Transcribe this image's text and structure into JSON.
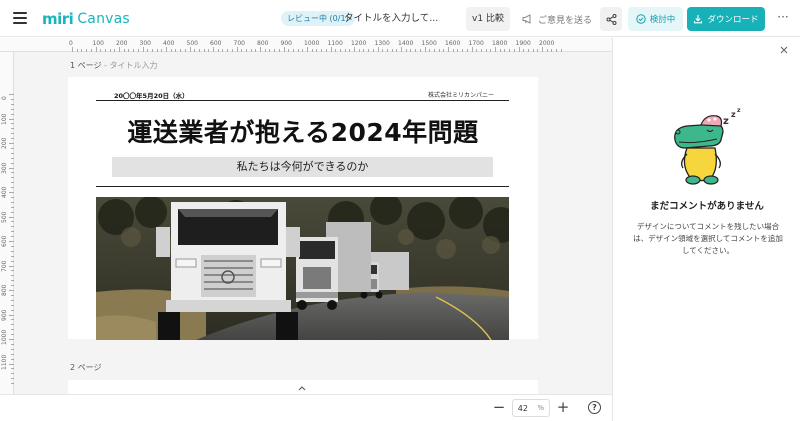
{
  "app": {
    "logo_mark": "miri",
    "logo_text": "Canvas"
  },
  "header": {
    "review_badge": "レビュー中 (0/1)",
    "doc_title": "タイトルを入力して...",
    "version_label": "v1 比較",
    "feedback_label": "ご意見を送る",
    "review_status_label": "検討中",
    "download_label": "ダウンロード",
    "more_label": "···"
  },
  "rulers": {
    "horizontal": [
      "0",
      "100",
      "200",
      "300",
      "400",
      "500",
      "600",
      "700",
      "800",
      "900",
      "1000",
      "1100",
      "1200",
      "1300",
      "1400",
      "1500",
      "1600",
      "1700",
      "1800",
      "1900",
      "2000"
    ],
    "vertical": [
      "0",
      "100",
      "200",
      "300",
      "400",
      "500",
      "600",
      "700",
      "800",
      "900",
      "1000",
      "1100"
    ]
  },
  "pages": [
    {
      "label": "1 ページ",
      "sub_label": "- タイトル入力",
      "date": "20〇〇年5月20日（水）",
      "company": "株式会社ミリカンパニー",
      "headline": "運送業者が抱える2024年問題",
      "subtitle": "私たちは今何ができるのか"
    },
    {
      "label": "2 ページ"
    }
  ],
  "zoom": {
    "value": "42",
    "unit": "%",
    "minus": "−",
    "plus": "+"
  },
  "help_label": "?",
  "comments_panel": {
    "empty_title": "まだコメントがありません",
    "empty_description": "デザインについてコメントを残したい場合は、デザイン領域を選択してコメントを追加してください。"
  },
  "colors": {
    "brand": "#17b6bd",
    "download_bg": "#18b1b8",
    "review_bg": "#e4f6f7",
    "canvas_bg": "#f4f4f5"
  },
  "icons": [
    "hamburger-icon",
    "megaphone-icon",
    "share-icon",
    "check-circle-icon",
    "download-icon",
    "close-icon",
    "chevron-up-icon",
    "help-icon"
  ]
}
